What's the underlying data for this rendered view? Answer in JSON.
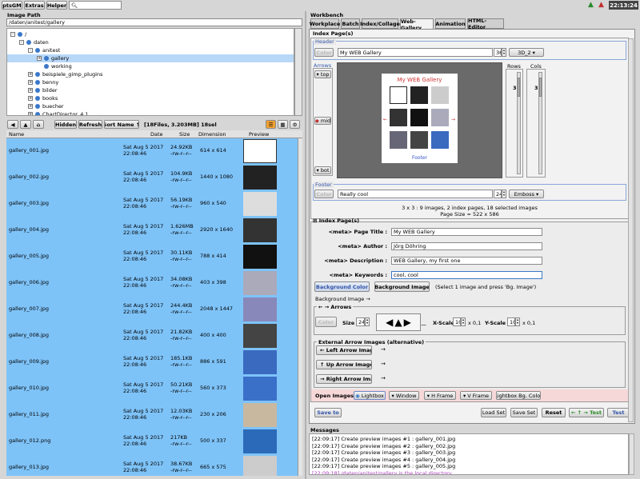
{
  "menu": {
    "app": "ptsGM",
    "extras": "Extras",
    "helper": "Helper",
    "search_icon": "search-icon"
  },
  "clock": "22:13:24",
  "image_path": {
    "label": "Image Path",
    "value": "/daten/anitest/gallery"
  },
  "tree": [
    {
      "label": "/",
      "indent": 0,
      "pm": "-"
    },
    {
      "label": "daten",
      "indent": 1,
      "pm": "-"
    },
    {
      "label": "anitest",
      "indent": 2,
      "pm": "-"
    },
    {
      "label": "gallery",
      "indent": 3,
      "pm": "+",
      "selected": true
    },
    {
      "label": "working",
      "indent": 3,
      "pm": ""
    },
    {
      "label": "beispiele_gimp_plugins",
      "indent": 2,
      "pm": "+"
    },
    {
      "label": "benny",
      "indent": 2,
      "pm": "+"
    },
    {
      "label": "bilder",
      "indent": 2,
      "pm": "+"
    },
    {
      "label": "books",
      "indent": 2,
      "pm": "+"
    },
    {
      "label": "buecher",
      "indent": 2,
      "pm": "+"
    },
    {
      "label": "ChartDirector_4.1",
      "indent": 2,
      "pm": "+"
    }
  ],
  "filebar": {
    "hidden": "Hidden",
    "refresh": "Refresh",
    "sort": "Sort Name ↑",
    "info": "[18Files, 3.203MB] 18sel"
  },
  "columns": {
    "name": "Name",
    "date": "Date",
    "size": "Size",
    "dim": "Dimension",
    "preview": "Preview"
  },
  "files": [
    {
      "name": "gallery_001.jpg",
      "date1": "Sat Aug  5  2017",
      "date2": "22:08:46",
      "size": "24.92KB",
      "perm": "-rw-r--r--",
      "dim": "614 x 614"
    },
    {
      "name": "gallery_002.jpg",
      "date1": "Sat Aug  5  2017",
      "date2": "22:08:46",
      "size": "104.9KB",
      "perm": "-rw-r--r--",
      "dim": "1440 x 1080"
    },
    {
      "name": "gallery_003.jpg",
      "date1": "Sat Aug  5  2017",
      "date2": "22:08:46",
      "size": "56.19KB",
      "perm": "-rw-r--r--",
      "dim": "960 x 540"
    },
    {
      "name": "gallery_004.jpg",
      "date1": "Sat Aug  5  2017",
      "date2": "22:08:46",
      "size": "1.626MB",
      "perm": "-rw-r--r--",
      "dim": "2920 x 1640"
    },
    {
      "name": "gallery_005.jpg",
      "date1": "Sat Aug  5  2017",
      "date2": "22:08:46",
      "size": "30.11KB",
      "perm": "-rw-r--r--",
      "dim": "788 x 414"
    },
    {
      "name": "gallery_006.jpg",
      "date1": "Sat Aug  5  2017",
      "date2": "22:08:46",
      "size": "34.08KB",
      "perm": "-rw-r--r--",
      "dim": "403 x 398"
    },
    {
      "name": "gallery_007.jpg",
      "date1": "Sat Aug  5  2017",
      "date2": "22:08:46",
      "size": "244.4KB",
      "perm": "-rw-r--r--",
      "dim": "2048 x 1447"
    },
    {
      "name": "gallery_008.jpg",
      "date1": "Sat Aug  5  2017",
      "date2": "22:08:46",
      "size": "21.82KB",
      "perm": "-rw-r--r--",
      "dim": "400 x 400"
    },
    {
      "name": "gallery_009.jpg",
      "date1": "Sat Aug  5  2017",
      "date2": "22:08:46",
      "size": "185.1KB",
      "perm": "-rw-r--r--",
      "dim": "886 x 591"
    },
    {
      "name": "gallery_010.jpg",
      "date1": "Sat Aug  5  2017",
      "date2": "22:08:46",
      "size": "50.21KB",
      "perm": "-rw-r--r--",
      "dim": "560 x 373"
    },
    {
      "name": "gallery_011.jpg",
      "date1": "Sat Aug  5  2017",
      "date2": "22:08:46",
      "size": "12.03KB",
      "perm": "-rw-r--r--",
      "dim": "230 x 206"
    },
    {
      "name": "gallery_012.png",
      "date1": "Sat Aug  5  2017",
      "date2": "22:08:46",
      "size": "217KB",
      "perm": "-rw-r--r--",
      "dim": "500 x 337"
    },
    {
      "name": "gallery_013.jpg",
      "date1": "Sat Aug  5  2017",
      "date2": "22:08:46",
      "size": "38.67KB",
      "perm": "-rw-r--r--",
      "dim": "665 x 575"
    }
  ],
  "workbench": {
    "title": "Workbench",
    "tabs": [
      "Workplace",
      "Batch",
      "Index/Collage",
      "Web-Gallery",
      "Animation",
      "HTML-Editor"
    ],
    "active_tab": 3
  },
  "index_pages_top": {
    "title": "Index Page(s)",
    "header": {
      "label": "Header",
      "color_btn": "Color",
      "text": "My WEB Gallery",
      "font_size": "36",
      "style": "3D_2"
    },
    "arrows": {
      "label": "Arrows",
      "top": "top",
      "mid": "mid",
      "bot": "bot"
    },
    "rows": {
      "label": "Rows",
      "value": "3"
    },
    "cols": {
      "label": "Cols",
      "value": "3"
    },
    "preview": {
      "title": "My WEB Gallery",
      "footer": "Footer"
    },
    "footer": {
      "label": "Footer",
      "color_btn": "Color",
      "text": "Really cool",
      "font_size": "24",
      "style": "Emboss"
    },
    "summary1": "3 x 3 : 9 images, 2 index pages, 18 selected images",
    "summary2": "Page Size = 522 x 586"
  },
  "index_pages": {
    "title": "Index Page(s)",
    "page_title_label": "<meta> Page Title :",
    "page_title": "My WEB Gallery",
    "author_label": "<meta> Author :",
    "author": "Jörg Döhring",
    "description_label": "<meta> Description :",
    "description": "WEB Gallery, my first one",
    "keywords_label": "<meta> Keywords :",
    "keywords": "cool, cool",
    "bg_color": "Background Color",
    "bg_image": "Background Image",
    "bg_hint": "(Select 1 image and press 'Bg. Image')",
    "bg_image_label": "Background Image →",
    "arrows_title": "← → Arrows",
    "color_btn": "Color",
    "size_label": "Size",
    "size_value": "24",
    "xscale_label": "X-Scale",
    "xscale_value": "10",
    "xscale_unit": "x 0,1",
    "yscale_label": "Y-Scale",
    "yscale_value": "10",
    "yscale_unit": "x 0,1",
    "ext_title": "External Arrow Images (alternative)",
    "left_arrow": "← Left Arrow Image",
    "up_arrow": "↑ Up Arrow Image",
    "right_arrow": "→ Right Arrow Image",
    "open_images_label": "Open Images :",
    "open_lightbox": "Lightbox",
    "open_window": "Window",
    "open_hframe": "H Frame",
    "open_vframe": "V Frame",
    "lightbox_bg": "Lightbox Bg. Color"
  },
  "actions": {
    "save_to": "Save to",
    "load_set": "Load Set",
    "save_set": "Save Set",
    "reset": "Reset",
    "test_arrows": "← ↑ → Test",
    "test": "Test"
  },
  "messages": {
    "title": "Messages",
    "lines": [
      "[22:09:17] Create preview images #1 : gallery_001.jpg",
      "[22:09:17] Create preview images #2 : gallery_002.jpg",
      "[22:09:17] Create preview images #3 : gallery_003.jpg",
      "[22:09:17] Create preview images #4 : gallery_004.jpg",
      "[22:09:17] Create preview images #5 : gallery_005.jpg",
      "[22:09:18] /daten/anitest/gallery is the local directory"
    ],
    "highlight_color": "#b040c0"
  },
  "colors": {
    "file_bg": "#7ec3f8",
    "tree_sel": "#b8d8f8",
    "accent": "#3355aa"
  }
}
